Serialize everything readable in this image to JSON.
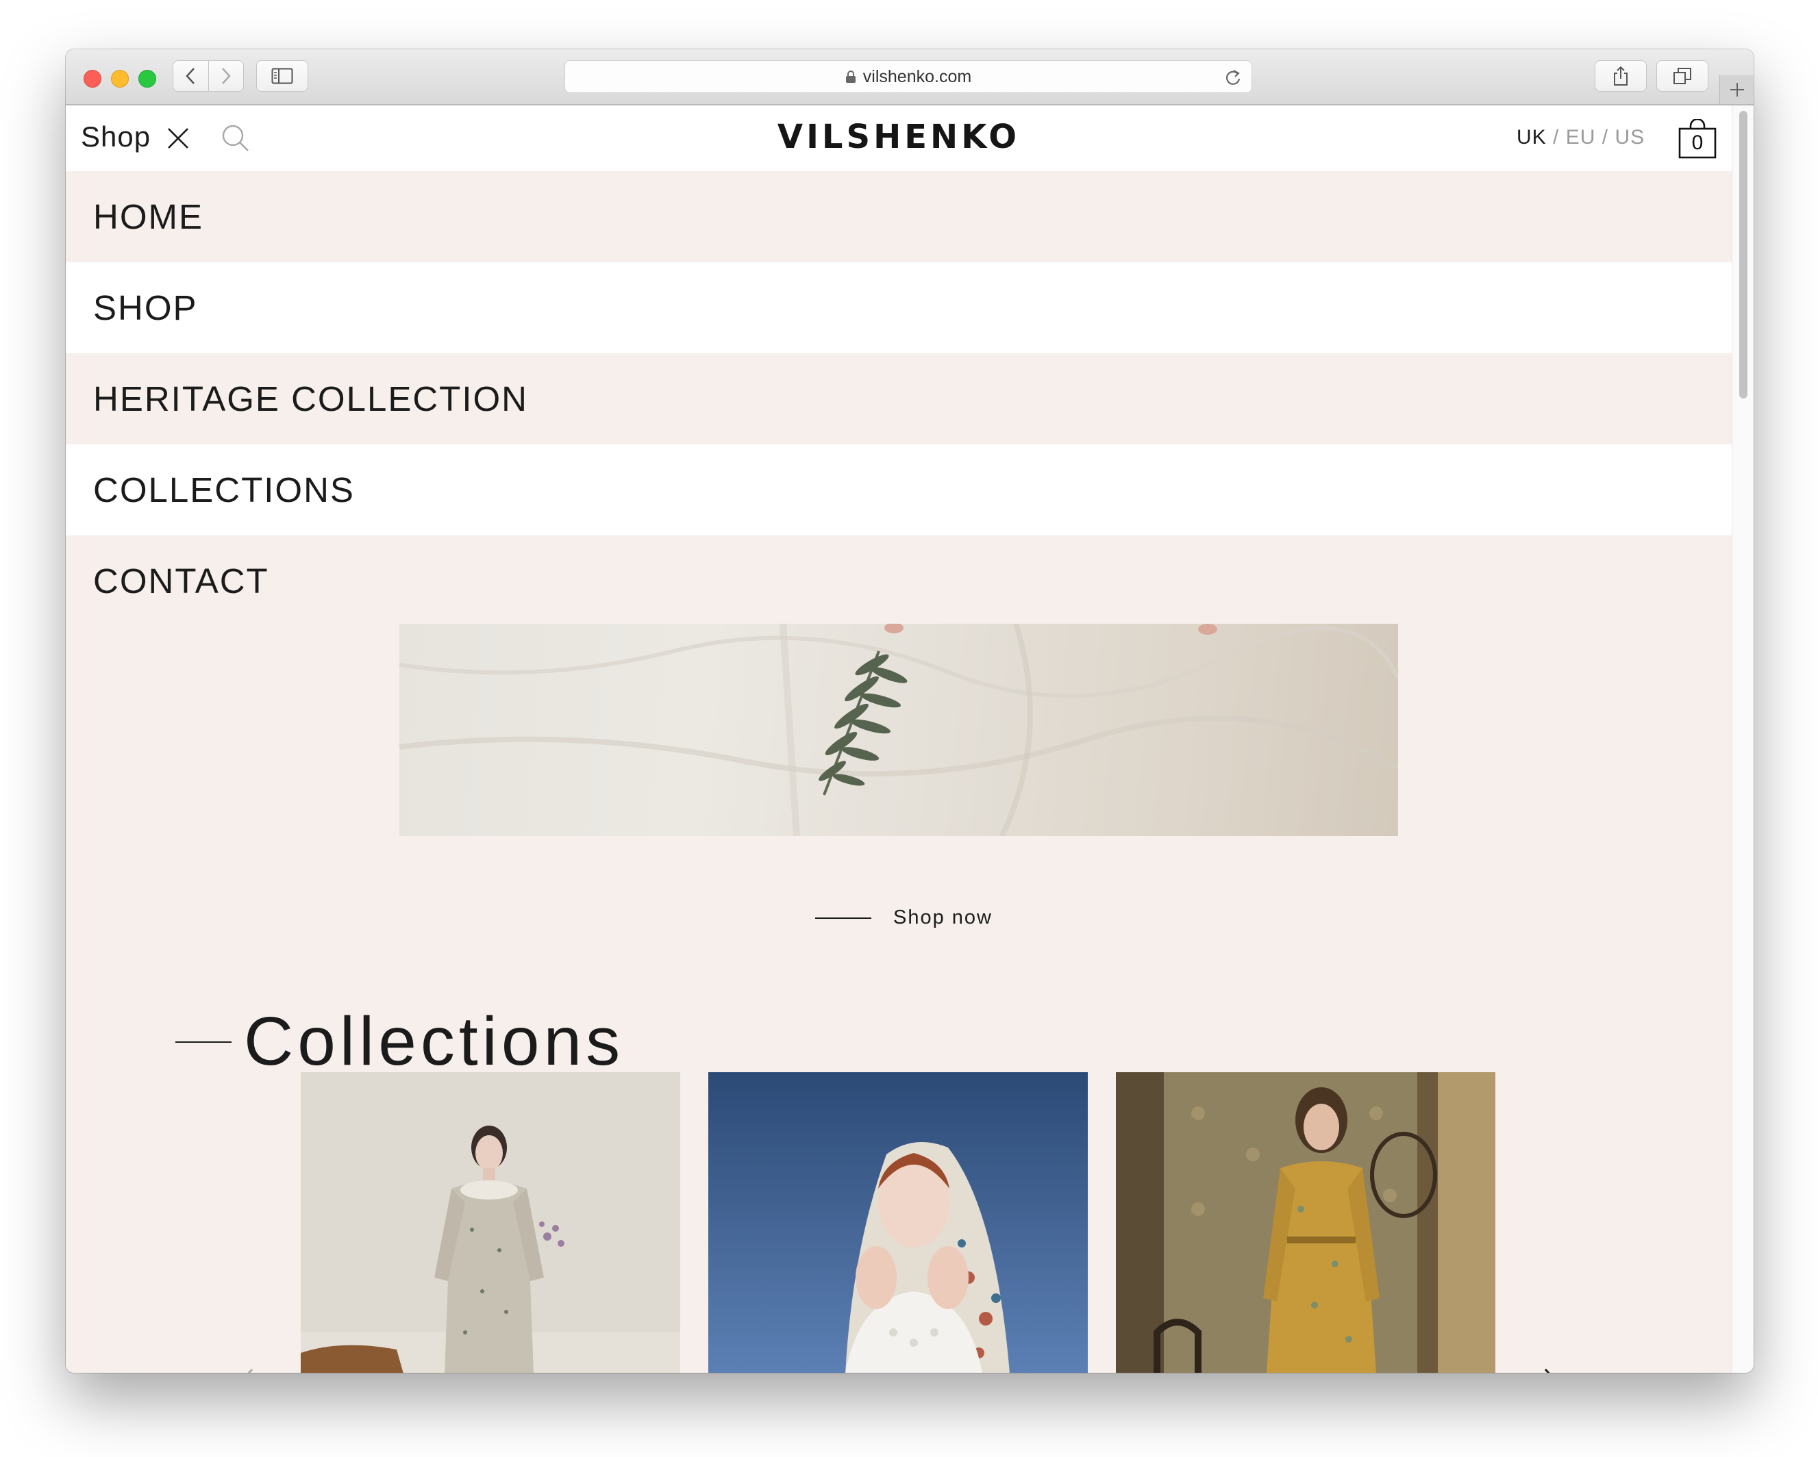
{
  "browser": {
    "url": "vilshenko.com",
    "icons": {
      "back": "chevron-left-icon",
      "forward": "chevron-right-icon",
      "sidebar": "sidebar-icon",
      "share": "share-icon",
      "tabs": "tabs-icon",
      "new_tab": "plus-icon",
      "lock": "lock-icon",
      "reload": "reload-icon"
    }
  },
  "header": {
    "shop_label": "Shop",
    "logo": "VILSHENKO",
    "regions": {
      "uk": "UK",
      "eu": "EU",
      "us": "US",
      "separator": "/"
    },
    "cart_count": "0"
  },
  "menu": {
    "items": [
      {
        "label": "HOME"
      },
      {
        "label": "SHOP"
      },
      {
        "label": "HERITAGE COLLECTION"
      },
      {
        "label": "COLLECTIONS"
      },
      {
        "label": "CONTACT"
      }
    ]
  },
  "hero": {
    "cta": "Shop now"
  },
  "collections": {
    "title": "Collections",
    "cards": [
      {
        "image": "model-floral-dress-photo"
      },
      {
        "image": "model-headscarf-blue-sky-photo"
      },
      {
        "image": "model-gold-dress-photo"
      }
    ]
  },
  "colors": {
    "page_bg": "#f6efeb",
    "text": "#1b1b1b",
    "muted": "#9a9a9a"
  }
}
